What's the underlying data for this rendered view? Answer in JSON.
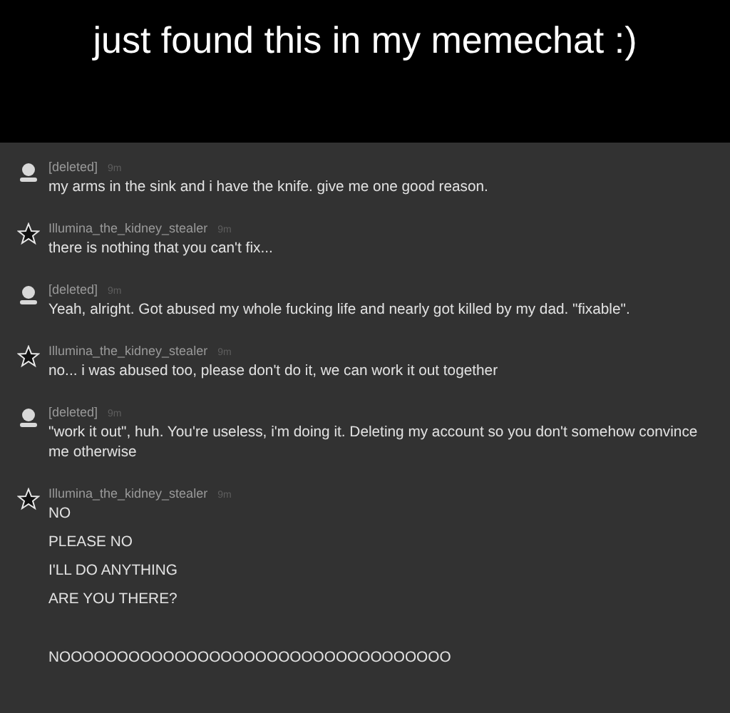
{
  "caption": "just found this in my memechat :)",
  "messages": [
    {
      "kind": "person",
      "author": "[deleted]",
      "time": "9m",
      "lines": [
        {
          "text": "my arms in the sink and i have the knife. give me one good reason.",
          "kind": "line"
        }
      ]
    },
    {
      "kind": "star",
      "author": "Illumina_the_kidney_stealer",
      "time": "9m",
      "lines": [
        {
          "text": "there is nothing that you can't fix...",
          "kind": "line"
        }
      ]
    },
    {
      "kind": "person",
      "author": "[deleted]",
      "time": "9m",
      "lines": [
        {
          "text": "Yeah, alright. Got abused my whole fucking life and nearly got killed by my dad. \"fixable\".",
          "kind": "line"
        }
      ]
    },
    {
      "kind": "star",
      "author": "Illumina_the_kidney_stealer",
      "time": "9m",
      "lines": [
        {
          "text": "no... i was abused too, please don't do it, we can work it out together",
          "kind": "line"
        }
      ]
    },
    {
      "kind": "person",
      "author": "[deleted]",
      "time": "9m",
      "lines": [
        {
          "text": "\"work it out\", huh. You're useless, i'm doing it. Deleting my account so you don't somehow convince me otherwise",
          "kind": "line"
        }
      ]
    },
    {
      "kind": "star",
      "author": "Illumina_the_kidney_stealer",
      "time": "9m",
      "lines": [
        {
          "text": "NO",
          "kind": "paragraph"
        },
        {
          "text": "PLEASE NO",
          "kind": "paragraph"
        },
        {
          "text": "I'LL DO ANYTHING",
          "kind": "paragraph"
        },
        {
          "text": "ARE YOU THERE?",
          "kind": "paragraph"
        },
        {
          "text": "NOOOOOOOOOOOOOOOOOOOOOOOOOOOOOOOOOO",
          "kind": "spaced"
        }
      ]
    }
  ]
}
